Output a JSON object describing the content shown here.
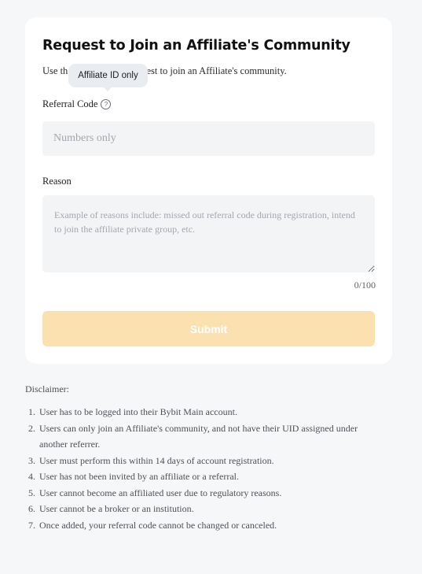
{
  "form": {
    "title": "Request to Join an Affiliate's Community",
    "intro_start": "Use th",
    "intro_end": "request to join an Affiliate's community.",
    "tooltip": "Affiliate ID only",
    "referral_label": "Referral Code",
    "referral_icon": "question-circle-icon",
    "referral_placeholder": "Numbers only",
    "referral_value": "",
    "reason_label": "Reason",
    "reason_placeholder": "Example of reasons include: missed out referral code during registration, intend to join the affiliate private group, etc.",
    "reason_value": "",
    "counter": "0/100",
    "submit_label": "Submit",
    "submit_color": "#fbe1b0"
  },
  "disclaimer": {
    "title": "Disclaimer:",
    "items": [
      {
        "num": "1.",
        "text": "User has to be logged into their Bybit Main account."
      },
      {
        "num": "2.",
        "text": "Users can only join an Affiliate's community, and not have their UID assigned under another referrer."
      },
      {
        "num": "3.",
        "text": "User must perform this within 14 days of account registration."
      },
      {
        "num": "4.",
        "text": "User has not been invited by an affiliate or a referral."
      },
      {
        "num": "5.",
        "text": "User cannot become an affiliated user due to regulatory reasons."
      },
      {
        "num": "6.",
        "text": "User cannot be a broker or an institution."
      },
      {
        "num": "7.",
        "text": "Once added, your referral code cannot be changed or canceled."
      }
    ]
  }
}
